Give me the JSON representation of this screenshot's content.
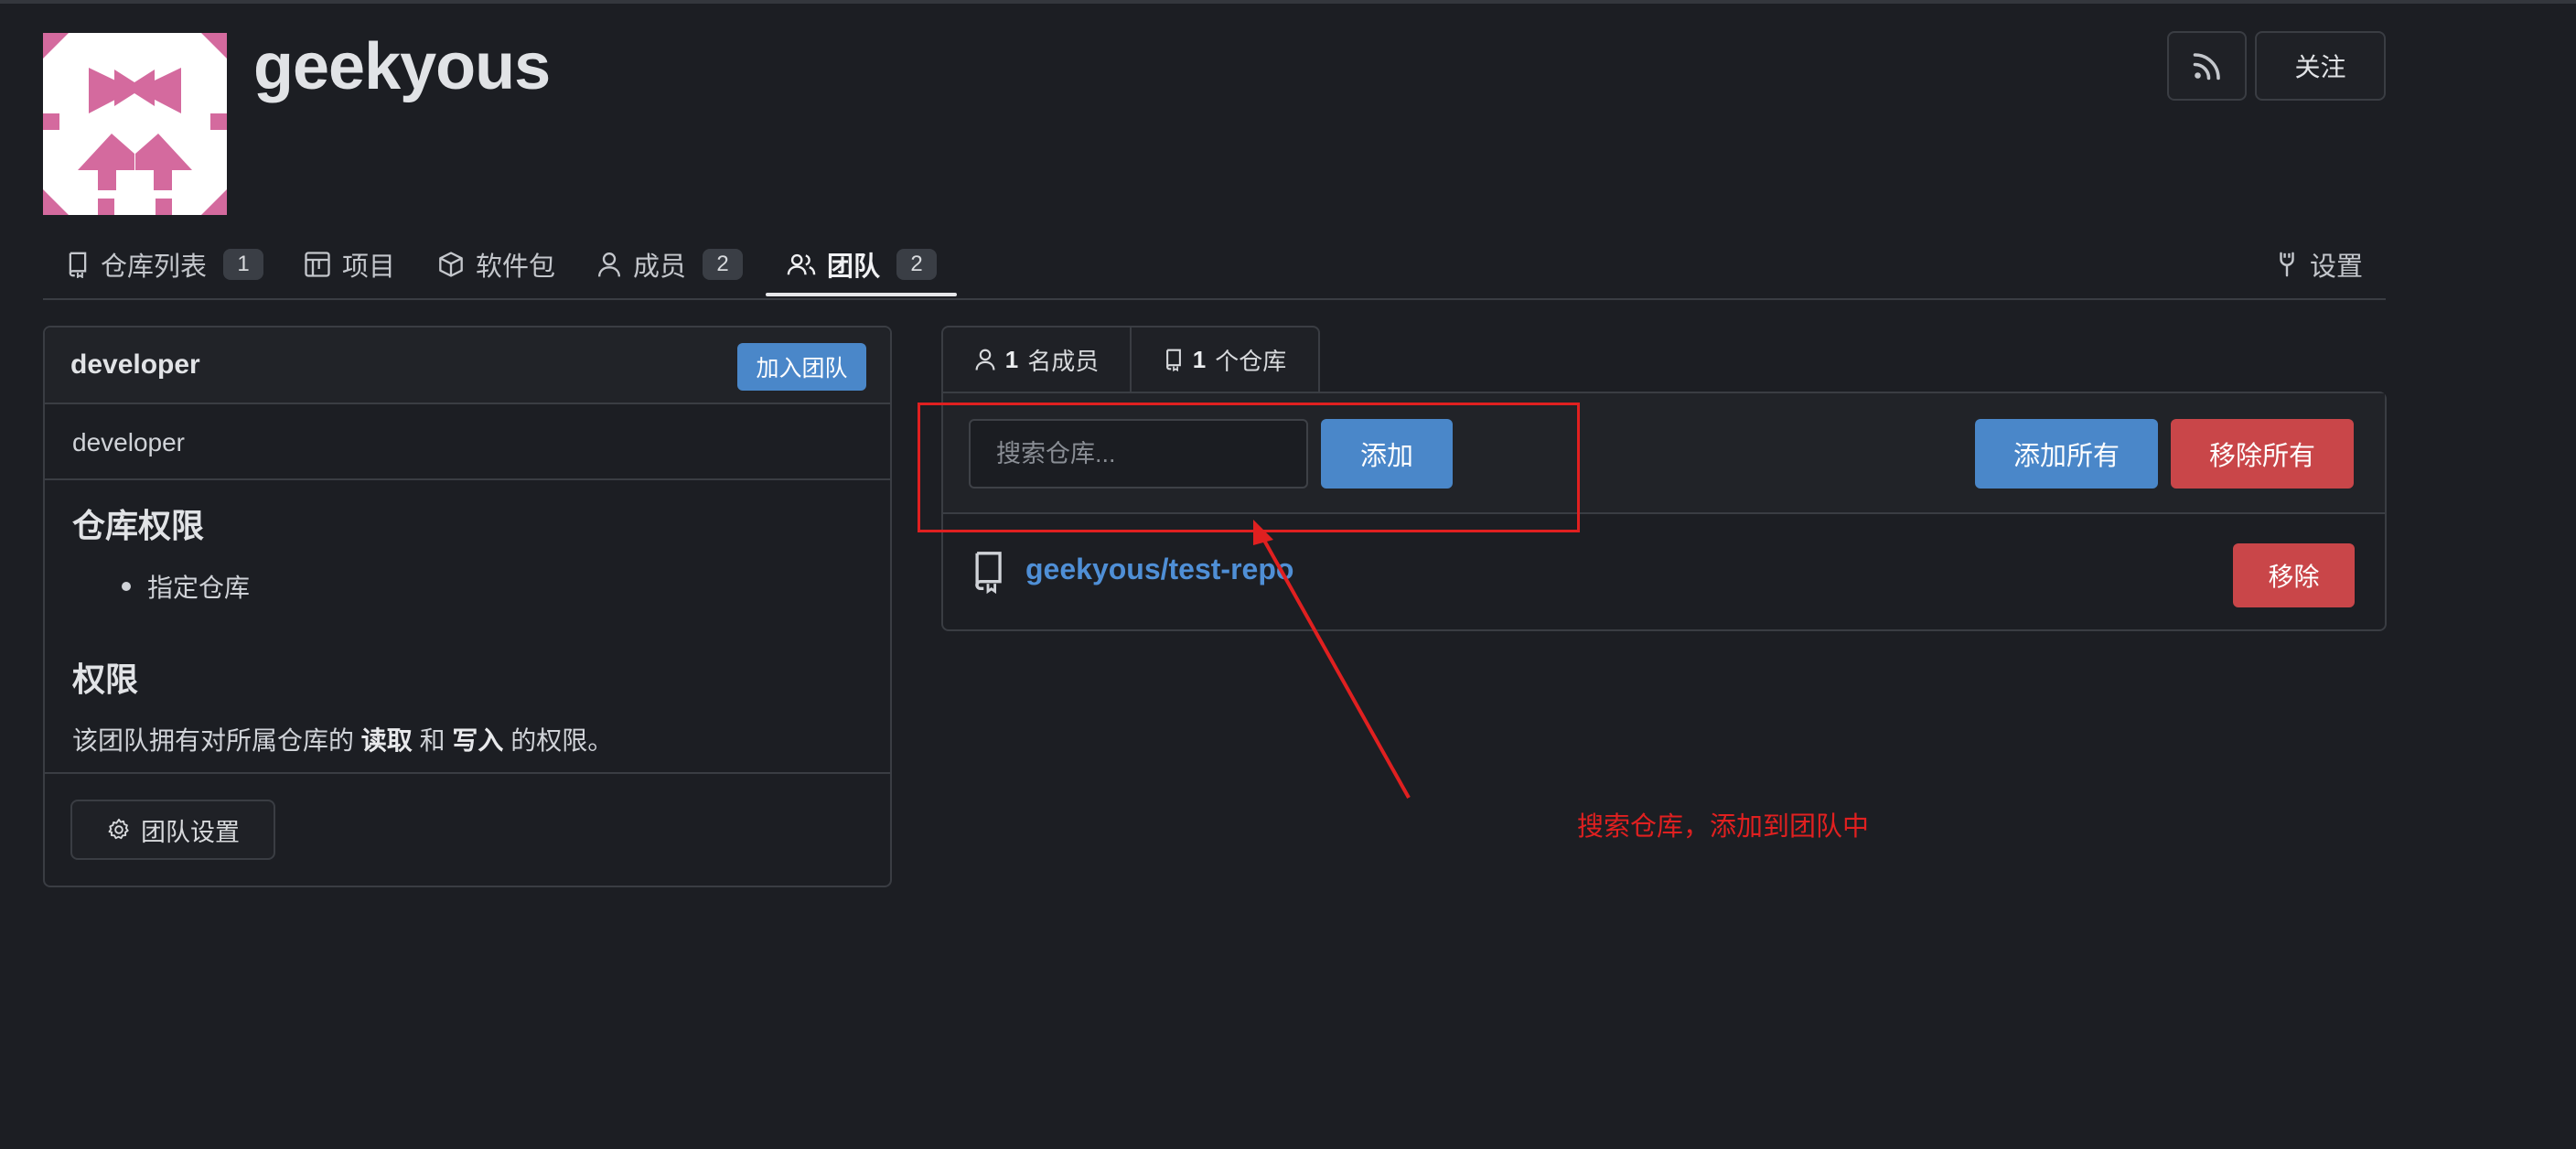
{
  "org": {
    "name": "geekyous"
  },
  "header": {
    "follow_label": "关注"
  },
  "tabs": [
    {
      "label": "仓库列表",
      "count": "1"
    },
    {
      "label": "项目"
    },
    {
      "label": "软件包"
    },
    {
      "label": "成员",
      "count": "2"
    },
    {
      "label": "团队",
      "count": "2",
      "active": true
    },
    {
      "label": "设置"
    }
  ],
  "team": {
    "name": "developer",
    "join_label": "加入团队",
    "description": "developer",
    "repo_access_title": "仓库权限",
    "repo_access_item": "指定仓库",
    "permission_title": "权限",
    "permission_text_pre": "该团队拥有对所属仓库的",
    "permission_read": "读取",
    "permission_and": "和",
    "permission_write": "写入",
    "permission_text_post": "的权限。",
    "settings_label": "团队设置"
  },
  "subtabs": {
    "members_count": "1",
    "members_label": "名成员",
    "repos_count": "1",
    "repos_label": "个仓库"
  },
  "repo_panel": {
    "search_placeholder": "搜索仓库...",
    "search_value": "",
    "add_label": "添加",
    "add_all_label": "添加所有",
    "remove_all_label": "移除所有",
    "repos": [
      {
        "name": "geekyous/test-repo",
        "remove_label": "移除"
      }
    ]
  },
  "annotation": {
    "text": "搜索仓库，添加到团队中",
    "color": "#e02020"
  },
  "colors": {
    "background": "#1c1e23",
    "accent": "#4a87c9",
    "danger": "#c94649",
    "link": "#4f8fd6"
  }
}
